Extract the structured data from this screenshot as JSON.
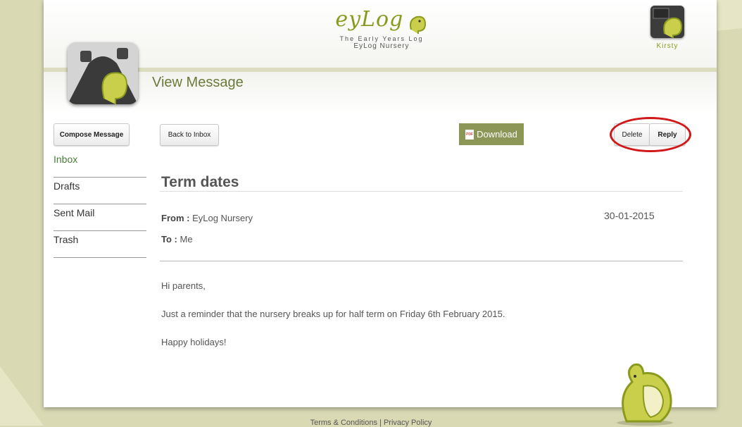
{
  "header": {
    "logo_word": "eyLog",
    "tagline": "The Early Years Log",
    "nursery_name": "EyLog Nursery",
    "user_name": "Kirsty"
  },
  "page_title": "View Message",
  "sidebar": {
    "compose_label": "Compose Message",
    "folders": [
      {
        "label": "Inbox"
      },
      {
        "label": "Drafts"
      },
      {
        "label": "Sent Mail"
      },
      {
        "label": "Trash"
      }
    ]
  },
  "toolbar": {
    "back_label": "Back to Inbox",
    "download_label": "Download",
    "pdf_icon_text": "PDF",
    "delete_label": "Delete",
    "reply_label": "Reply"
  },
  "message": {
    "subject": "Term dates",
    "from_label": "From :",
    "from_value": "EyLog Nursery",
    "to_label": "To :",
    "to_value": "Me",
    "date": "30-01-2015",
    "body": [
      "Hi parents,",
      "Just a reminder that the nursery breaks up for half term on Friday 6th February 2015.",
      "Happy holidays!"
    ]
  },
  "footer": {
    "terms": "Terms & Conditions",
    "separator": "|",
    "privacy": "Privacy Policy"
  },
  "colors": {
    "accent_green": "#8a9a1e",
    "download_bg": "#8c9656",
    "highlight_ring": "#d01818",
    "background": "#d9d9b4"
  },
  "icons": {
    "app": "road-elephant-app-icon",
    "avatar": "chalkboard-elephant-avatar",
    "mascot": "elephant-mascot-icon",
    "pdf": "pdf-file-icon"
  }
}
